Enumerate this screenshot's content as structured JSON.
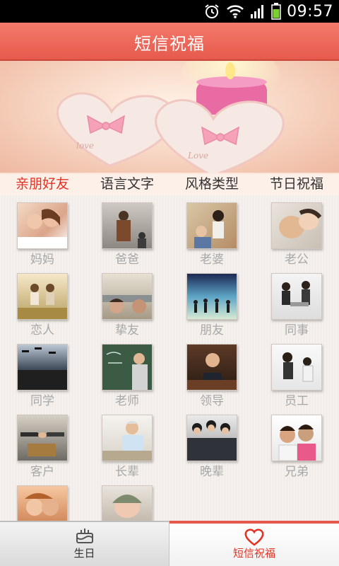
{
  "status_bar": {
    "time": "09:57"
  },
  "header": {
    "title": "短信祝福"
  },
  "tabs": [
    {
      "label": "亲朋好友",
      "active": true
    },
    {
      "label": "语言文字",
      "active": false
    },
    {
      "label": "风格类型",
      "active": false
    },
    {
      "label": "节日祝福",
      "active": false
    }
  ],
  "grid": {
    "items": [
      {
        "label": "妈妈"
      },
      {
        "label": "爸爸"
      },
      {
        "label": "老婆"
      },
      {
        "label": "老公"
      },
      {
        "label": "恋人"
      },
      {
        "label": "挚友"
      },
      {
        "label": "朋友"
      },
      {
        "label": "同事"
      },
      {
        "label": "同学"
      },
      {
        "label": "老师"
      },
      {
        "label": "领导"
      },
      {
        "label": "员工"
      },
      {
        "label": "客户"
      },
      {
        "label": "长辈"
      },
      {
        "label": "晚辈"
      },
      {
        "label": "兄弟"
      },
      {
        "label": ""
      },
      {
        "label": ""
      }
    ]
  },
  "bottom_nav": [
    {
      "label": "生日",
      "icon": "birthday-cake-icon",
      "active": false
    },
    {
      "label": "短信祝福",
      "icon": "heart-icon",
      "active": true
    }
  ],
  "colors": {
    "accent": "#e65a4c",
    "active_tab": "#e53121"
  }
}
